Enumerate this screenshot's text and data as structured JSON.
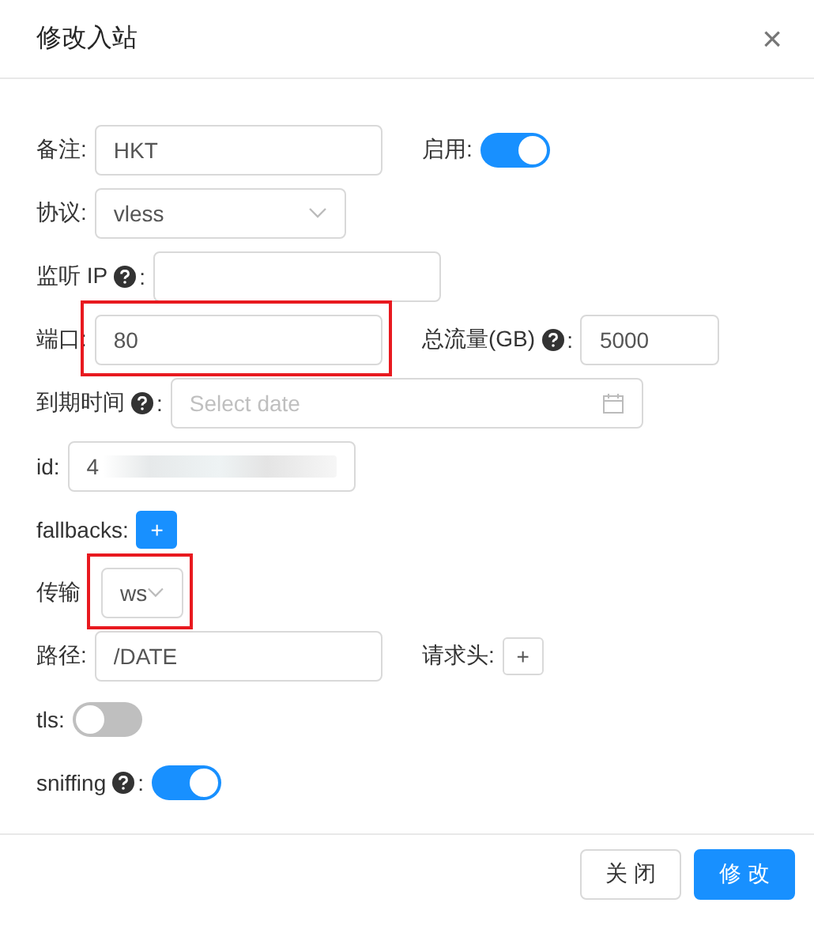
{
  "dialog": {
    "title": "修改入站",
    "close": "×"
  },
  "rows": [
    {
      "fields": [
        {
          "label": "备注:",
          "kind": "input",
          "value": "HKT"
        },
        {
          "label": "启用:",
          "kind": "toggle",
          "on": true
        }
      ]
    },
    {
      "fields": [
        {
          "label": "协议:",
          "kind": "select",
          "value": "vless"
        }
      ]
    },
    {
      "fields": [
        {
          "label": "监听 IP",
          "help": true,
          "label_end": ":",
          "kind": "input"
        }
      ]
    },
    {
      "fields": [
        {
          "label": "端口:",
          "kind": "input",
          "value": "80",
          "highlighted": true
        },
        {
          "label": "总流量(GB)",
          "help": true,
          "label_end": ":",
          "kind": "input",
          "value": "5000"
        }
      ]
    },
    {
      "fields": [
        {
          "label": "到期时间",
          "help": true,
          "label_end": ":",
          "kind": "date",
          "placeholder": "Select date"
        }
      ]
    },
    {
      "fields": [
        {
          "label": "id:",
          "kind": "input",
          "value": "4",
          "redacted": true
        }
      ]
    },
    {
      "fields": [
        {
          "label": "fallbacks:",
          "kind": "add",
          "primary": true,
          "text": "+"
        }
      ]
    },
    {
      "fields": [
        {
          "label": "传输",
          "kind": "select",
          "value": "ws",
          "highlighted": true
        }
      ]
    },
    {
      "fields": [
        {
          "label": "路径:",
          "kind": "input",
          "value": "/DATE"
        },
        {
          "label": "请求头:",
          "kind": "add",
          "primary": false,
          "text": "+"
        }
      ]
    },
    {
      "fields": [
        {
          "label": "tls:",
          "kind": "toggle",
          "on": false
        }
      ]
    },
    {
      "fields": [
        {
          "label": "sniffing",
          "help": true,
          "label_end": ":",
          "kind": "toggle",
          "on": true
        }
      ]
    }
  ],
  "buttons": [
    {
      "label": "关 闭",
      "primary": false
    },
    {
      "label": "修 改",
      "primary": true
    }
  ]
}
